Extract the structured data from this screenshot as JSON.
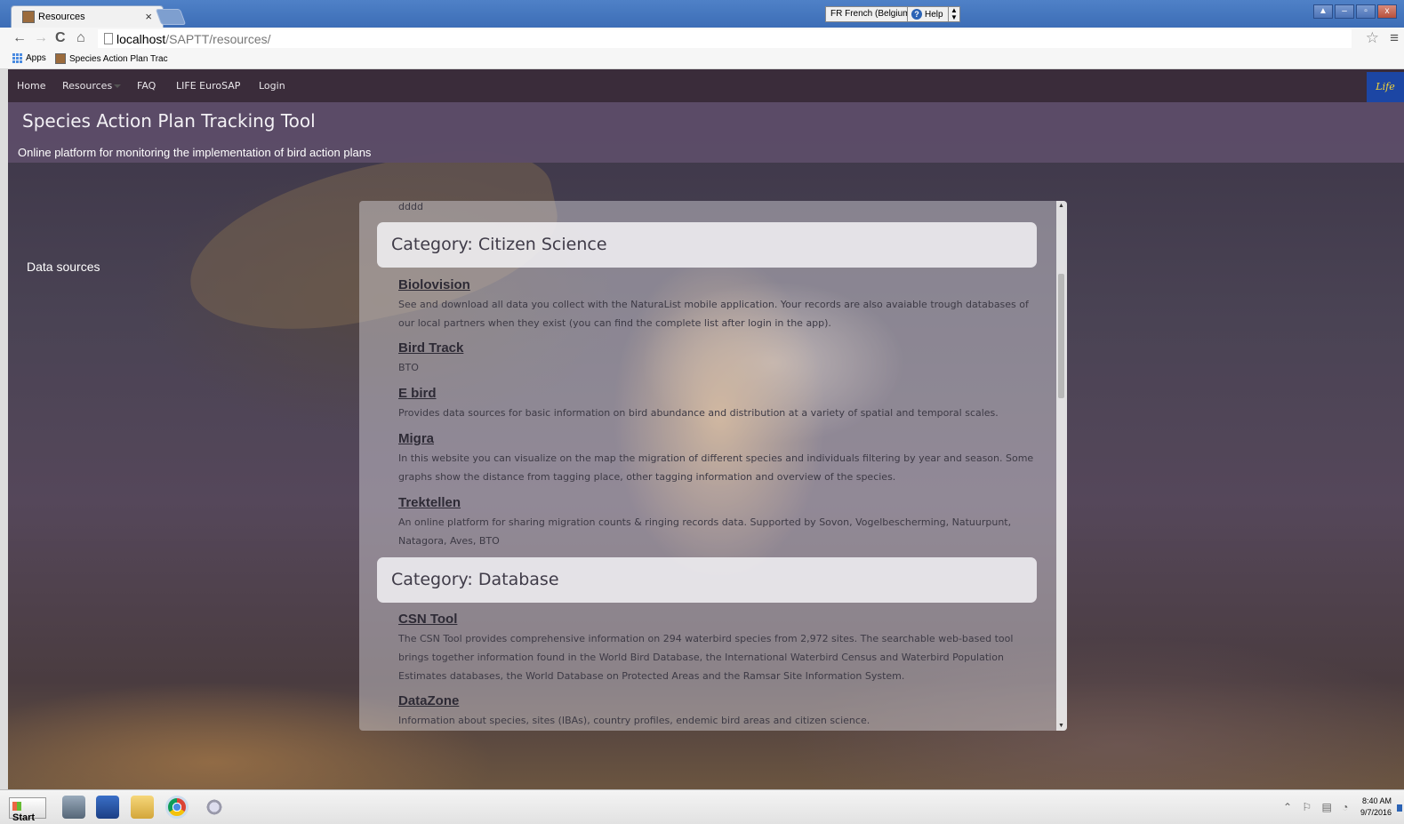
{
  "browser": {
    "tab_title": "Resources",
    "tab_close": "×",
    "language": "FR French (Belgium)",
    "help": "Help",
    "url_host": "localhost",
    "url_path": "/SAPTT/resources/",
    "bookmarks": [
      {
        "label": "Apps"
      },
      {
        "label": "Species Action Plan Trac"
      }
    ],
    "window_controls": [
      "▲",
      "–",
      "▫",
      "x"
    ]
  },
  "site": {
    "nav": {
      "home": "Home",
      "resources": "Resources",
      "faq": "FAQ",
      "life": "LIFE EuroSAP",
      "login": "Login"
    },
    "logo_text": "Life",
    "title": "Species Action Plan Tracking Tool",
    "subtitle": "Online platform for monitoring the implementation of bird action plans",
    "side_heading": "Data sources"
  },
  "panel": {
    "stray_text": "dddd",
    "categories": [
      {
        "label": "Category: Citizen Science",
        "resources": [
          {
            "title": "Biolovision",
            "description": "See and download all data you collect with the NaturaList mobile application. Your records are also avaiable trough databases of our local partners when they exist (you can find the complete list after login in the app)."
          },
          {
            "title": "Bird Track",
            "description": "BTO"
          },
          {
            "title": "E bird",
            "description": "Provides data sources for basic information on bird abundance and distribution at a variety of spatial and temporal scales."
          },
          {
            "title": "Migra",
            "description": "In this website you can visualize on the map the migration of different species and individuals filtering by year and season. Some graphs show the distance from tagging place, other tagging information and overview of the species."
          },
          {
            "title": "Trektellen",
            "description": "An online platform for sharing migration counts & ringing records data. Supported by Sovon, Vogelbescherming, Natuurpunt, Natagora, Aves, BTO"
          }
        ]
      },
      {
        "label": "Category: Database",
        "resources": [
          {
            "title": "CSN Tool",
            "description": "The CSN Tool provides comprehensive information on 294 waterbird species from 2,972 sites. The searchable web-based tool brings together information found in the World Bird Database, the International Waterbird Census and Waterbird Population Estimates databases, the World Database on Protected Areas and the Ramsar Site Information System."
          },
          {
            "title": "DataZone",
            "description": "Information about species, sites (IBAs), country profiles, endemic bird areas and citizen science."
          }
        ]
      }
    ]
  },
  "taskbar": {
    "start": "Start",
    "time": "8:40 AM",
    "date": "9/7/2016"
  }
}
